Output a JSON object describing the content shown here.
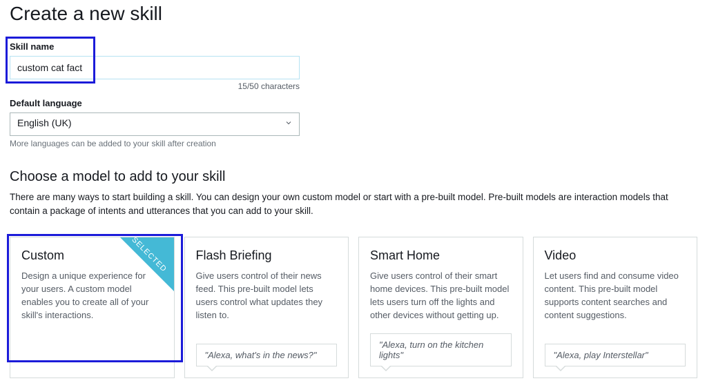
{
  "page_title": "Create a new skill",
  "skill_name": {
    "label": "Skill name",
    "value": "custom cat fact",
    "counter": "15/50  characters"
  },
  "language": {
    "label": "Default language",
    "selected": "English (UK)",
    "hint": "More languages can be added to your skill after creation"
  },
  "model_section": {
    "title": "Choose a model to add to your skill",
    "description": "There are many ways to start building a skill. You can design your own custom model or start with a pre-built model.  Pre-built models are interaction models that contain a package of intents and utterances that you can add to your skill."
  },
  "selected_ribbon": "SELECTED",
  "cards": [
    {
      "title": "Custom",
      "desc": "Design a unique experience for your users. A custom model enables you to create all of your skill's interactions.",
      "quote": "",
      "selected": true
    },
    {
      "title": "Flash Briefing",
      "desc": "Give users control of their news feed. This pre-built model lets users control what updates they listen to.",
      "quote": "\"Alexa, what's in the news?\""
    },
    {
      "title": "Smart Home",
      "desc": "Give users control of their smart home devices. This pre-built model lets users turn off the lights and other devices without getting up.",
      "quote": "\"Alexa, turn on the kitchen lights\""
    },
    {
      "title": "Video",
      "desc": "Let users find and consume video content. This pre-built model supports content searches and content suggestions.",
      "quote": "\"Alexa, play Interstellar\""
    }
  ]
}
